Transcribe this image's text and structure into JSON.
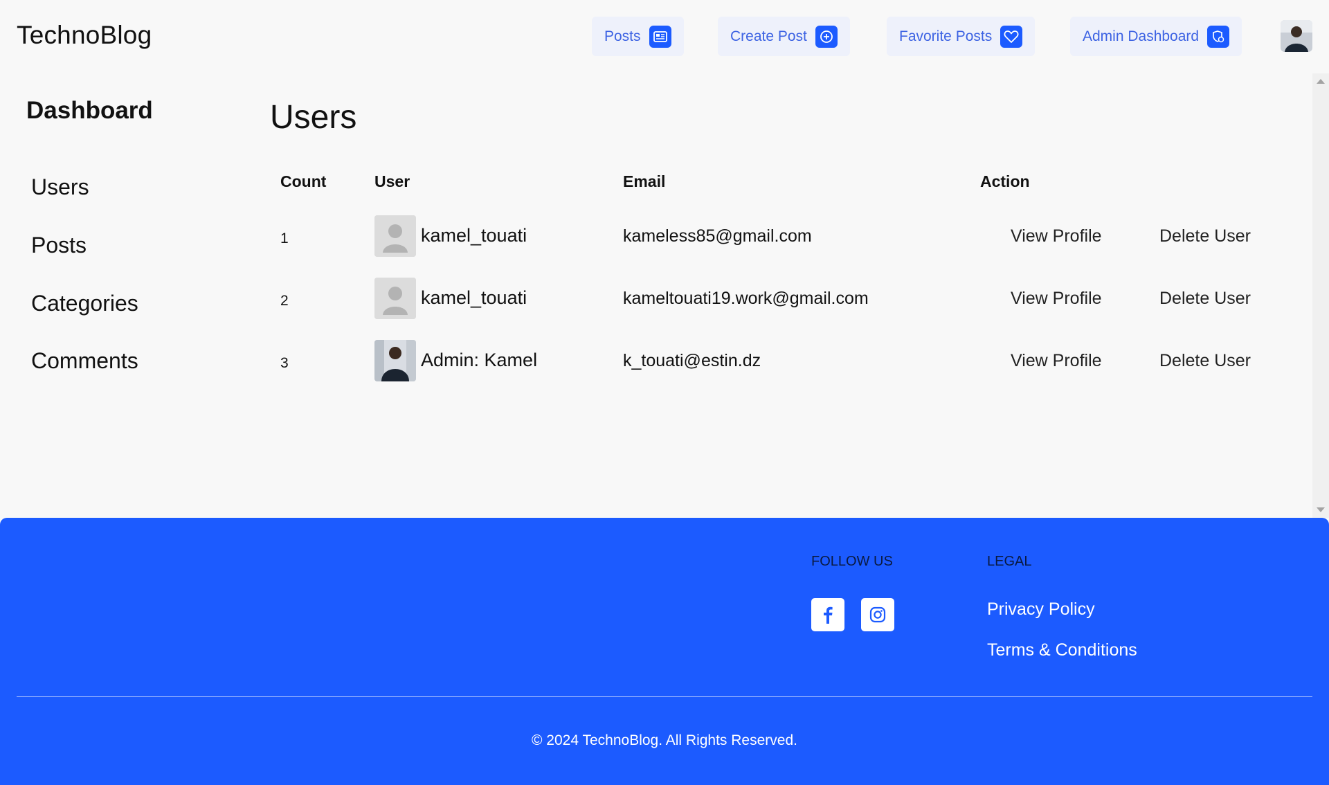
{
  "header": {
    "brand": "TechnoBlog",
    "nav": [
      {
        "label": "Posts",
        "icon": "newspaper-icon"
      },
      {
        "label": "Create Post",
        "icon": "plus-circle-icon"
      },
      {
        "label": "Favorite Posts",
        "icon": "heart-icon"
      },
      {
        "label": "Admin Dashboard",
        "icon": "admin-shield-icon"
      }
    ]
  },
  "sidebar": {
    "title": "Dashboard",
    "items": [
      {
        "label": "Users"
      },
      {
        "label": "Posts"
      },
      {
        "label": "Categories"
      },
      {
        "label": "Comments"
      }
    ]
  },
  "main": {
    "title": "Users",
    "columns": {
      "count": "Count",
      "user": "User",
      "email": "Email",
      "action": "Action"
    },
    "rows": [
      {
        "count": "1",
        "user": "kamel_touati",
        "email": "kameless85@gmail.com",
        "view": "View Profile",
        "delete": "Delete User",
        "avatar": "default-avatar"
      },
      {
        "count": "2",
        "user": "kamel_touati",
        "email": "kameltouati19.work@gmail.com",
        "view": "View Profile",
        "delete": "Delete User",
        "avatar": "default-avatar"
      },
      {
        "count": "3",
        "user": "Admin: Kamel",
        "email": "k_touati@estin.dz",
        "view": "View Profile",
        "delete": "Delete User",
        "avatar": "photo-avatar"
      }
    ]
  },
  "footer": {
    "follow_title": "FOLLOW US",
    "legal_title": "LEGAL",
    "social": [
      "facebook-icon",
      "instagram-icon"
    ],
    "links": [
      {
        "label": "Privacy Policy"
      },
      {
        "label": "Terms & Conditions"
      }
    ],
    "copyright": "© 2024 TechnoBlog. All Rights Reserved."
  },
  "colors": {
    "accent": "#1c5bff",
    "nav_bg": "#eef1fb",
    "nav_text": "#3d63e3",
    "page_bg": "#f8f8f8"
  }
}
